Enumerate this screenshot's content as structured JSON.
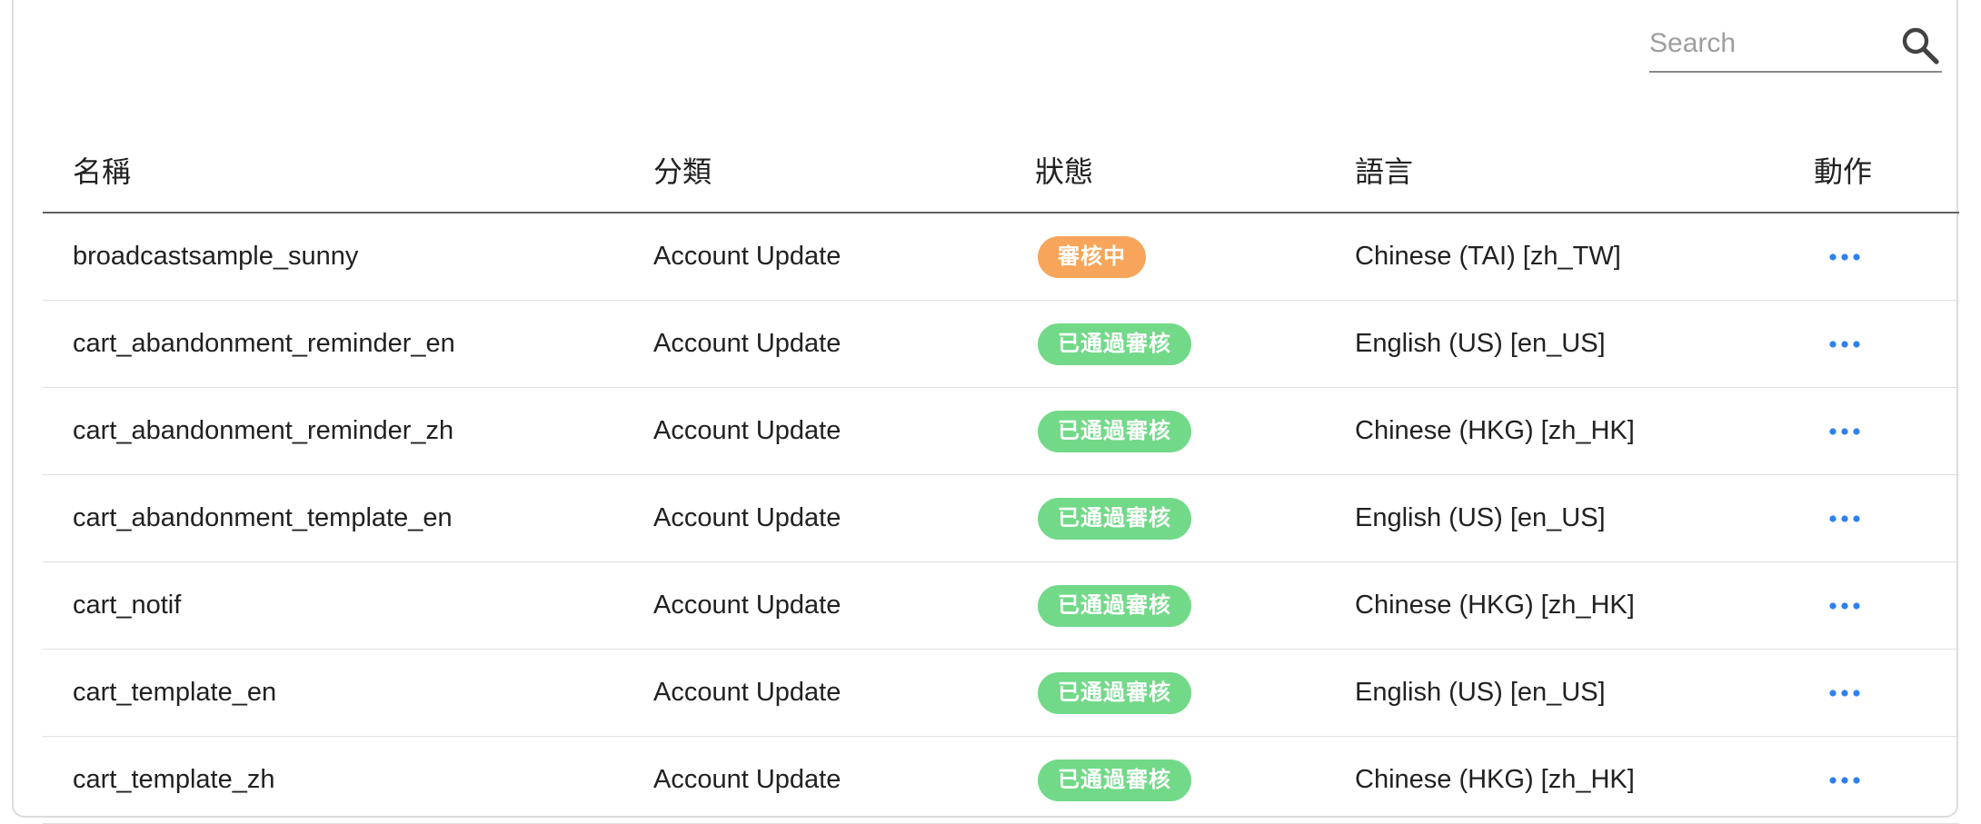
{
  "search": {
    "placeholder": "Search",
    "value": ""
  },
  "table": {
    "headers": {
      "name": "名稱",
      "category": "分類",
      "status": "狀態",
      "language": "語言",
      "actions": "動作"
    },
    "rows": [
      {
        "name": "broadcastsample_sunny",
        "category": "Account Update",
        "status": "審核中",
        "status_type": "pending",
        "language": "Chinese (TAI) [zh_TW]"
      },
      {
        "name": "cart_abandonment_reminder_en",
        "category": "Account Update",
        "status": "已通過審核",
        "status_type": "approved",
        "language": "English (US) [en_US]"
      },
      {
        "name": "cart_abandonment_reminder_zh",
        "category": "Account Update",
        "status": "已通過審核",
        "status_type": "approved",
        "language": "Chinese (HKG) [zh_HK]"
      },
      {
        "name": "cart_abandonment_template_en",
        "category": "Account Update",
        "status": "已通過審核",
        "status_type": "approved",
        "language": "English (US) [en_US]"
      },
      {
        "name": "cart_notif",
        "category": "Account Update",
        "status": "已通過審核",
        "status_type": "approved",
        "language": "Chinese (HKG) [zh_HK]"
      },
      {
        "name": "cart_template_en",
        "category": "Account Update",
        "status": "已通過審核",
        "status_type": "approved",
        "language": "English (US) [en_US]"
      },
      {
        "name": "cart_template_zh",
        "category": "Account Update",
        "status": "已通過審核",
        "status_type": "approved",
        "language": "Chinese (HKG) [zh_HK]"
      }
    ]
  },
  "icons": {
    "search": "search-icon",
    "row_action": "more-horizontal-icon"
  },
  "colors": {
    "pending_badge": "#f7a55a",
    "approved_badge": "#72d988",
    "action_icon": "#2f80ed",
    "header_rule": "#616161",
    "row_rule": "#e0e0e0"
  }
}
